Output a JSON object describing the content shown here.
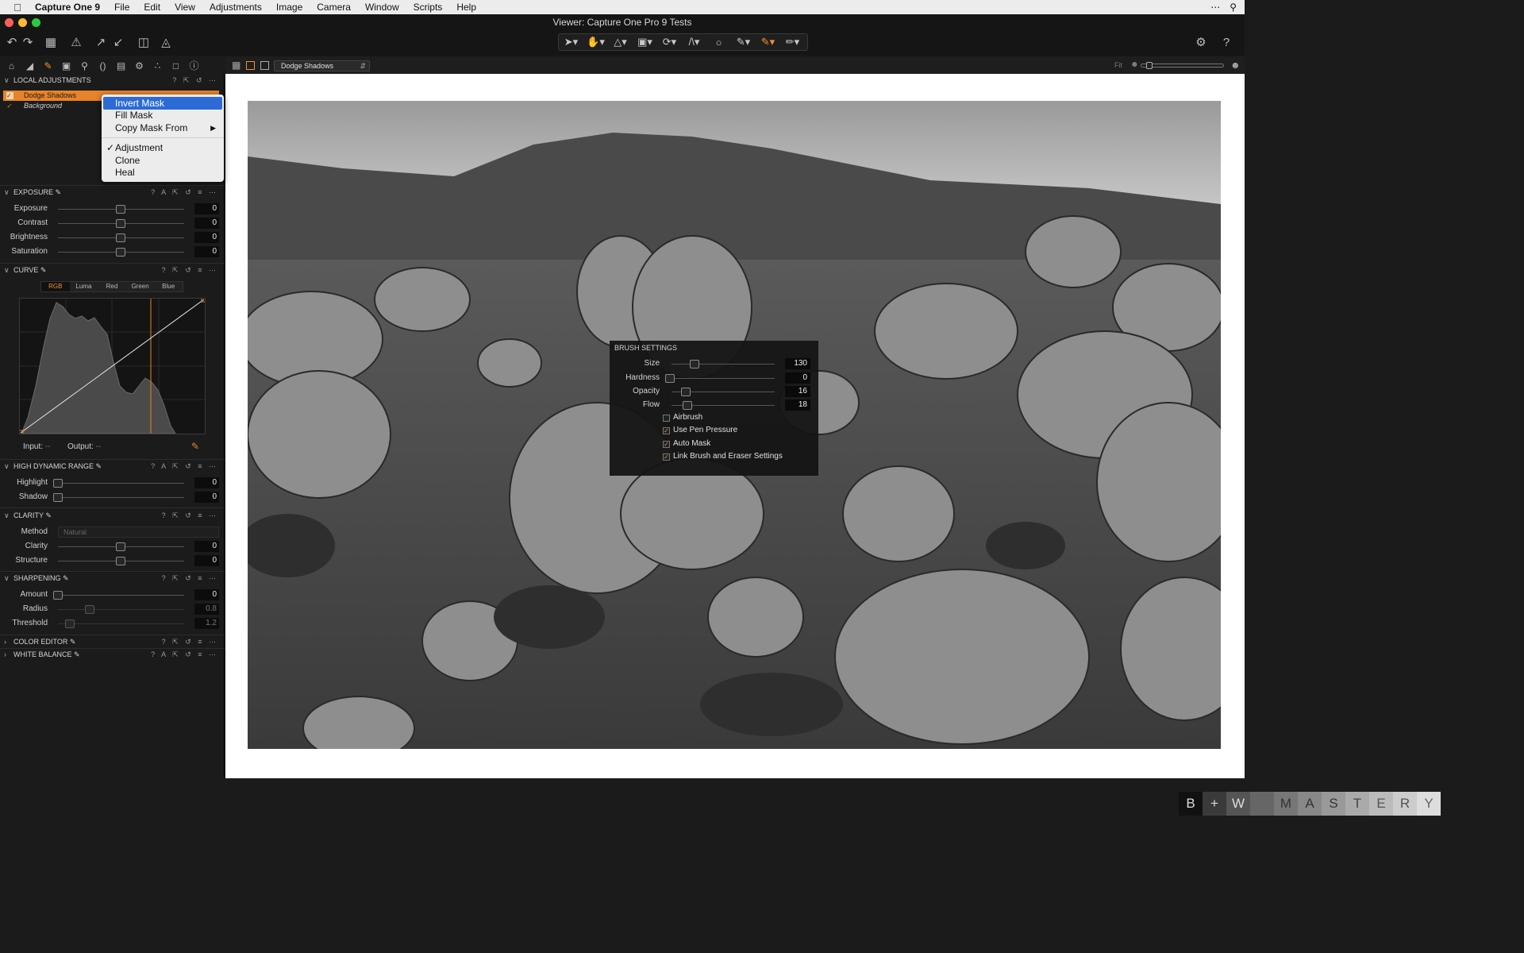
{
  "menubar": {
    "app_name": "Capture One 9",
    "items": [
      "File",
      "Edit",
      "View",
      "Adjustments",
      "Image",
      "Camera",
      "Window",
      "Scripts",
      "Help"
    ]
  },
  "window": {
    "title": "Viewer: Capture One Pro 9 Tests"
  },
  "viewer_header": {
    "layer_select": "Dodge Shadows",
    "fit_label": "Fit"
  },
  "local_adjustments": {
    "title": "LOCAL ADJUSTMENTS",
    "layers": [
      {
        "name": "Dodge Shadows",
        "selected": true
      },
      {
        "name": "Background",
        "selected": false
      }
    ]
  },
  "context_menu": {
    "items": [
      {
        "label": "Invert Mask",
        "highlighted": true
      },
      {
        "label": "Fill Mask"
      },
      {
        "label": "Copy Mask From",
        "submenu": true
      },
      {
        "label": "Adjustment",
        "checked": true
      },
      {
        "label": "Clone"
      },
      {
        "label": "Heal"
      }
    ]
  },
  "exposure": {
    "title": "EXPOSURE",
    "sliders": [
      {
        "label": "Exposure",
        "value": "0"
      },
      {
        "label": "Contrast",
        "value": "0"
      },
      {
        "label": "Brightness",
        "value": "0"
      },
      {
        "label": "Saturation",
        "value": "0"
      }
    ]
  },
  "curve": {
    "title": "CURVE",
    "tabs": [
      "RGB",
      "Luma",
      "Red",
      "Green",
      "Blue"
    ],
    "active_tab": "RGB",
    "input_label": "Input:",
    "input_value": "--",
    "output_label": "Output:",
    "output_value": "--"
  },
  "hdr": {
    "title": "HIGH DYNAMIC RANGE",
    "sliders": [
      {
        "label": "Highlight",
        "value": "0"
      },
      {
        "label": "Shadow",
        "value": "0"
      }
    ]
  },
  "clarity": {
    "title": "CLARITY",
    "method_label": "Method",
    "method_value": "Natural",
    "sliders": [
      {
        "label": "Clarity",
        "value": "0"
      },
      {
        "label": "Structure",
        "value": "0"
      }
    ]
  },
  "sharpening": {
    "title": "SHARPENING",
    "sliders": [
      {
        "label": "Amount",
        "value": "0"
      },
      {
        "label": "Radius",
        "value": "0.8"
      },
      {
        "label": "Threshold",
        "value": "1.2"
      }
    ]
  },
  "color_editor": {
    "title": "COLOR EDITOR"
  },
  "white_balance": {
    "title": "WHITE BALANCE"
  },
  "brush_settings": {
    "title": "BRUSH SETTINGS",
    "sliders": [
      {
        "label": "Size",
        "value": "130"
      },
      {
        "label": "Hardness",
        "value": "0"
      },
      {
        "label": "Opacity",
        "value": "16"
      },
      {
        "label": "Flow",
        "value": "18"
      }
    ],
    "checks": [
      {
        "label": "Airbrush",
        "checked": false
      },
      {
        "label": "Use Pen Pressure",
        "checked": true
      },
      {
        "label": "Auto Mask",
        "checked": true
      },
      {
        "label": "Link Brush and Eraser Settings",
        "checked": true
      }
    ]
  },
  "watermark": [
    "B",
    "+",
    "W",
    "",
    "M",
    "A",
    "S",
    "T",
    "E",
    "R",
    "Y"
  ],
  "colors": {
    "accent": "#f0922a",
    "menu_highlight": "#2c6bd6",
    "panel_bg": "#1b1b1b"
  }
}
